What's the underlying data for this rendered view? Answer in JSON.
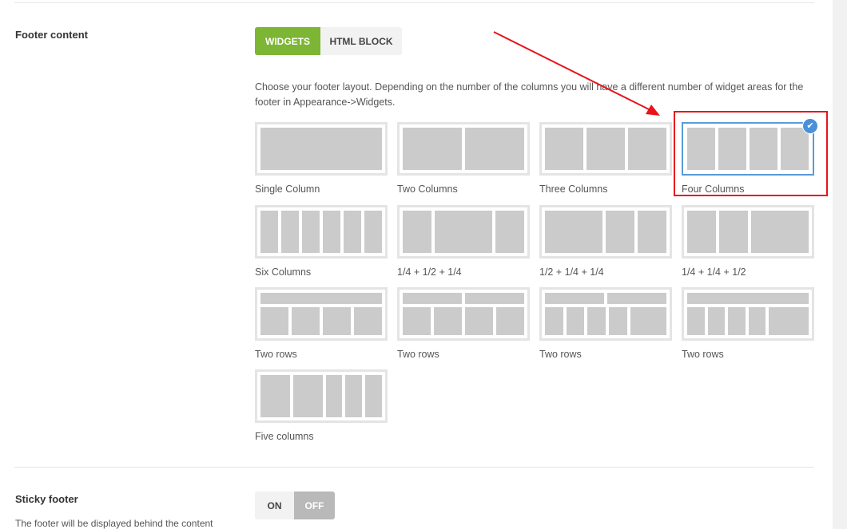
{
  "footer_content": {
    "label": "Footer content",
    "tabs": [
      {
        "label": "WIDGETS",
        "active": true
      },
      {
        "label": "HTML BLOCK",
        "active": false
      }
    ],
    "description": "Choose your footer layout. Depending on the number of the columns you will have a different number of widget areas for the footer in Appearance->Widgets.",
    "layouts": [
      {
        "label": "Single Column",
        "selected": false
      },
      {
        "label": "Two Columns",
        "selected": false
      },
      {
        "label": "Three Columns",
        "selected": false
      },
      {
        "label": "Four Columns",
        "selected": true
      },
      {
        "label": "Six Columns",
        "selected": false
      },
      {
        "label": "1/4 + 1/2 + 1/4",
        "selected": false
      },
      {
        "label": "1/2 + 1/4 + 1/4",
        "selected": false
      },
      {
        "label": "1/4 + 1/4 + 1/2",
        "selected": false
      },
      {
        "label": "Two rows",
        "selected": false
      },
      {
        "label": "Two rows",
        "selected": false
      },
      {
        "label": "Two rows",
        "selected": false
      },
      {
        "label": "Two rows",
        "selected": false
      },
      {
        "label": "Five columns",
        "selected": false
      }
    ]
  },
  "sticky_footer": {
    "label": "Sticky footer",
    "description": "The footer will be displayed behind the content",
    "options": [
      {
        "label": "ON",
        "active": false
      },
      {
        "label": "OFF",
        "active": true
      }
    ]
  },
  "colors": {
    "accent_green": "#7db534",
    "selected_blue": "#5a9ad8",
    "annotation_red": "#e8141c"
  },
  "icons": {
    "selected_check": "checkmark-icon"
  }
}
